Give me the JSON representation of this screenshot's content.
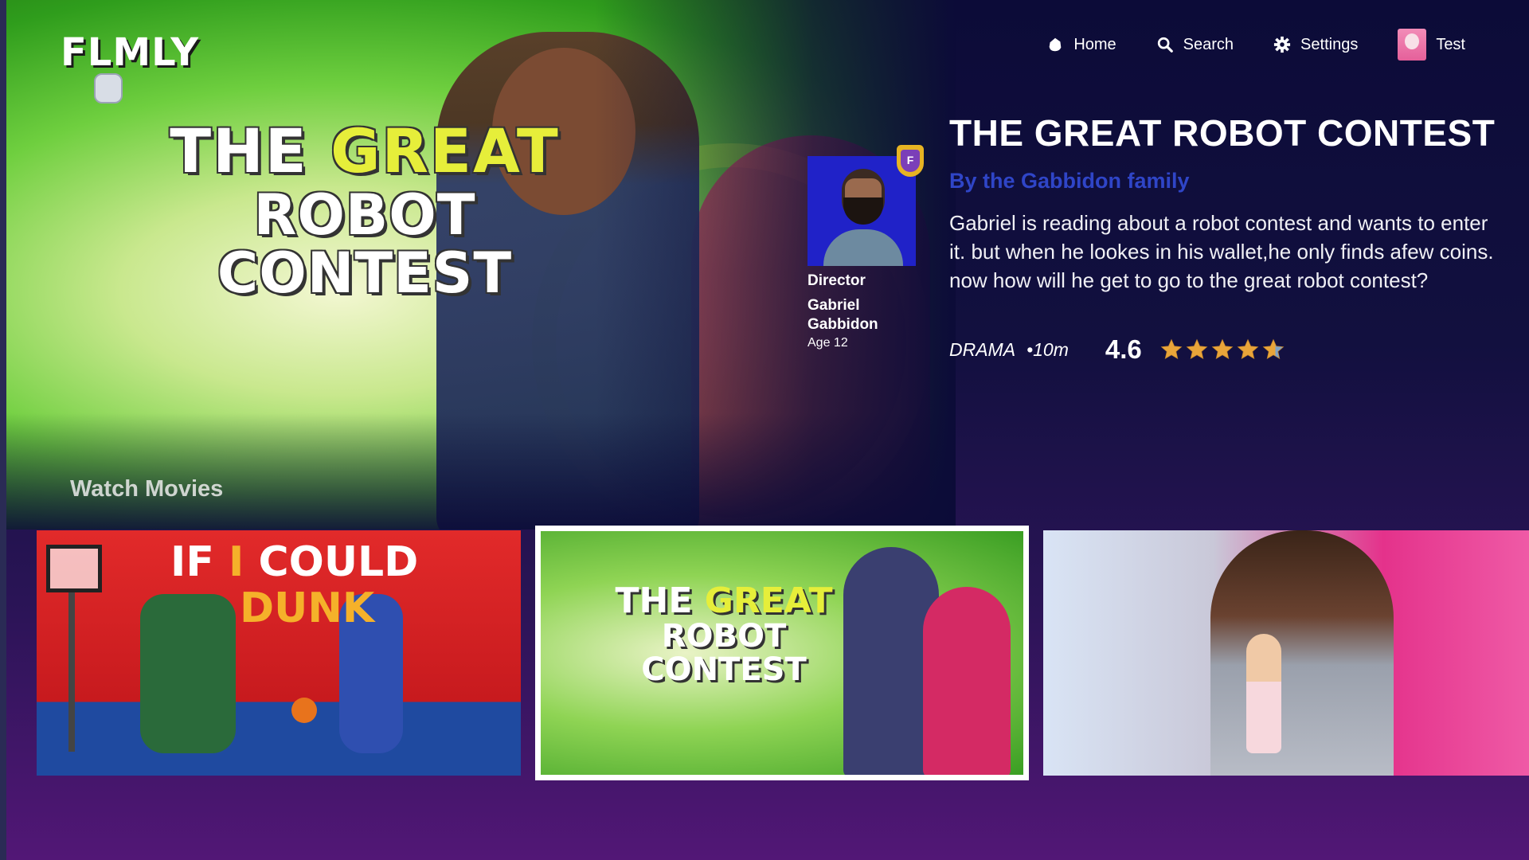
{
  "app": {
    "logo_text": "FLMLY"
  },
  "nav": {
    "home": {
      "label": "Home",
      "icon": "home-icon"
    },
    "search": {
      "label": "Search",
      "icon": "search-icon"
    },
    "settings": {
      "label": "Settings",
      "icon": "gear-icon"
    },
    "profile": {
      "label": "Test",
      "icon": "avatar"
    }
  },
  "hero": {
    "poster_title_line1_a": "THE ",
    "poster_title_line1_b": "GREAT",
    "poster_title_line2": "ROBOT CONTEST",
    "section_label": "Watch Movies"
  },
  "director": {
    "role": "Director",
    "name": "Gabriel Gabbidon",
    "age": "Age 12",
    "badge_letter": "F"
  },
  "movie": {
    "title": "THE GREAT ROBOT CONTEST",
    "byline": "By the Gabbidon family",
    "description": "Gabriel is reading about a robot contest and wants to enter it. but when he lookes in his wallet,he only finds afew coins. now how will he get to go to the great robot contest?",
    "genre": "DRAMA",
    "duration": "•10m",
    "rating": "4.6",
    "rating_value": 4.6,
    "rating_max": 5
  },
  "row": {
    "tiles": [
      {
        "title_line1_a": "IF ",
        "title_line1_b": "I",
        "title_line1_c": " COULD",
        "title_line2": "DUNK"
      },
      {
        "title_line1_a": "THE ",
        "title_line1_b": "GREAT",
        "title_line2": "ROBOT CONTEST",
        "selected": true
      },
      {
        "title": ""
      }
    ]
  },
  "colors": {
    "background_top": "#0c0b38",
    "background_bottom": "#521776",
    "byline": "#2f45c7",
    "star": "#e9a53a"
  }
}
